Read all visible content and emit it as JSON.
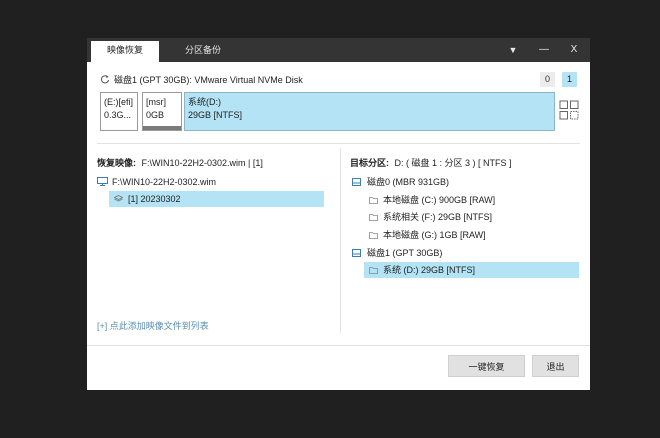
{
  "tabs": {
    "restore": "映像恢复",
    "backup": "分区备份"
  },
  "window_buttons": {
    "menu": "▼",
    "minimize": "—",
    "close": "X"
  },
  "disk": {
    "title": "磁盘1 (GPT 30GB): VMware Virtual NVMe Disk",
    "indices": [
      "0",
      "1"
    ],
    "partitions": [
      {
        "name": "(E:)[efi]",
        "size": "0.3G..."
      },
      {
        "name": "[msr]",
        "size": "0GB"
      },
      {
        "name": "系统(D:)",
        "size": "29GB [NTFS]"
      }
    ]
  },
  "left": {
    "image_label": "恢复映像:",
    "image_value": "F:\\WIN10-22H2-0302.wim | [1]",
    "tree_root": "F:\\WIN10-22H2-0302.wim",
    "tree_child": "[1] 20230302",
    "add_link": "[+] 点此添加映像文件到列表"
  },
  "right": {
    "target_label": "目标分区:",
    "target_value": "D: ( 磁盘 1 : 分区 3 ) [ NTFS ]",
    "disk0": "磁盘0 (MBR 931GB)",
    "disk0_parts": [
      "本地磁盘 (C:) 900GB [RAW]",
      "系统相关 (F:) 29GB [NTFS]",
      "本地磁盘 (G:) 1GB [RAW]"
    ],
    "disk1": "磁盘1 (GPT 30GB)",
    "disk1_parts": [
      "系统 (D:) 29GB [NTFS]"
    ]
  },
  "buttons": {
    "restore": "一键恢复",
    "exit": "退出"
  },
  "colors": {
    "selection": "#b3e3f4",
    "titlebar": "#343434",
    "link": "#5a8fb0"
  }
}
